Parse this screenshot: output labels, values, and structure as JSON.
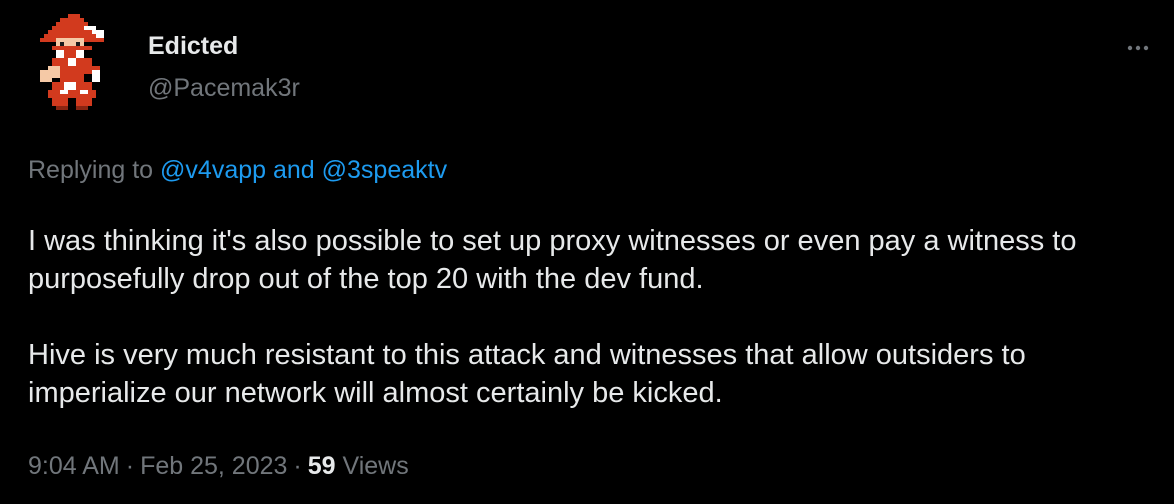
{
  "author": {
    "display_name": "Edicted",
    "handle": "@Pacemak3r",
    "avatar_icon": "pixel-red-mage-avatar-icon"
  },
  "more_icon": "more-dots-icon",
  "reply": {
    "prefix": "Replying to ",
    "user1": "@v4vapp",
    "conjunction": " and ",
    "user2": "@3speaktv"
  },
  "tweet": {
    "paragraphs": [
      "I was thinking it's also possible to set up proxy witnesses or even pay a witness to purposefully drop out of the top 20 with the dev fund.",
      "Hive is very much resistant to this attack and witnesses that allow outsiders to imperialize our network will almost certainly be kicked."
    ]
  },
  "meta": {
    "time": "9:04 AM",
    "separator": "·",
    "date": "Feb 25, 2023",
    "views_count": "59",
    "views_label": "Views"
  },
  "colors": {
    "background": "#000000",
    "text": "#e7e9ea",
    "muted": "#71767b",
    "link": "#1d9bf0"
  }
}
